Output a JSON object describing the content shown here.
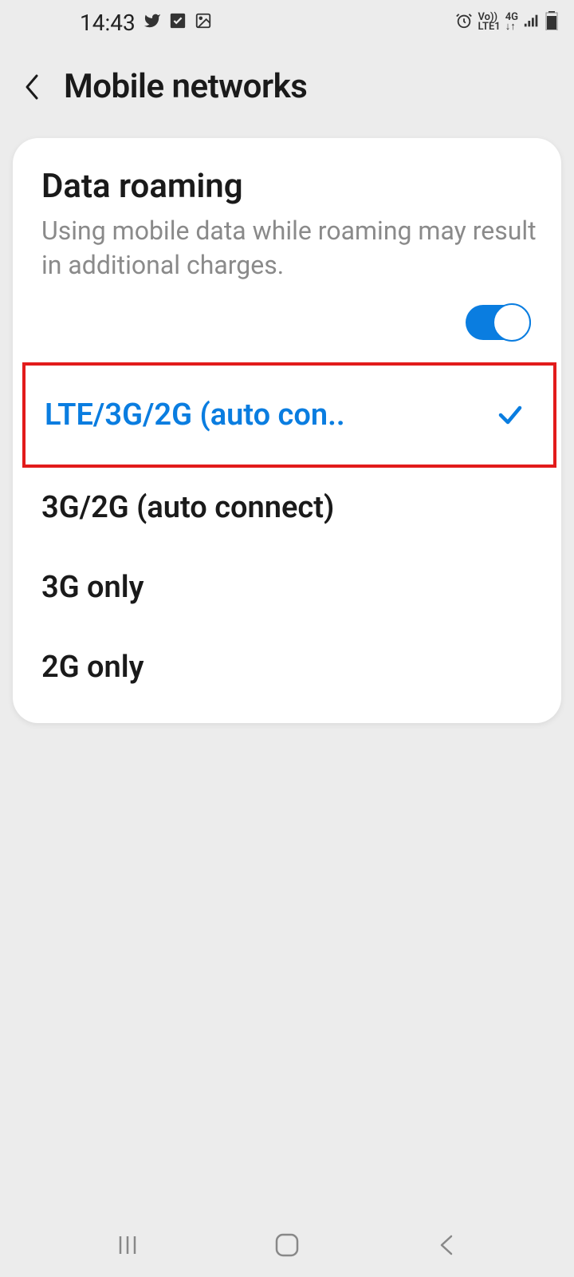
{
  "statusBar": {
    "time": "14:43",
    "volte": "Vo))",
    "lte": "LTE1",
    "netgen": "4G"
  },
  "header": {
    "title": "Mobile networks"
  },
  "roaming": {
    "title": "Data roaming",
    "description": "Using mobile data while roaming may result in additional charges.",
    "enabled": true
  },
  "networkModes": {
    "options": [
      {
        "label": "LTE/3G/2G (auto con..",
        "selected": true
      },
      {
        "label": "3G/2G (auto connect)",
        "selected": false
      },
      {
        "label": "3G only",
        "selected": false
      },
      {
        "label": "2G only",
        "selected": false
      }
    ]
  }
}
